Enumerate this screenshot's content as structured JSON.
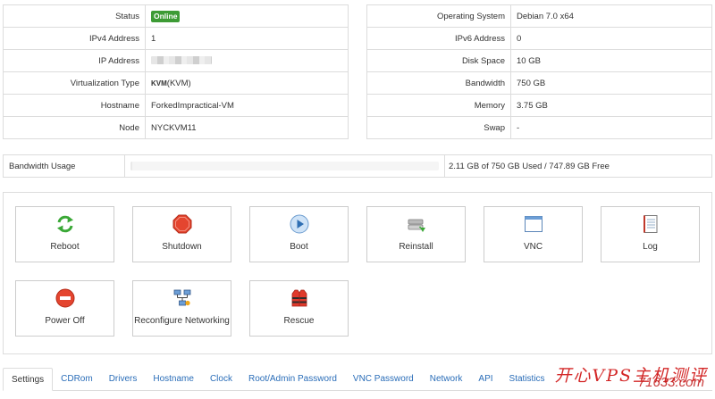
{
  "server_info_left": {
    "status_label": "Status",
    "status_value": "Online",
    "ipv4_label": "IPv4 Address",
    "ipv4_value": "1",
    "ip_label": "IP Address",
    "virt_label": "Virtualization Type",
    "virt_prefix": "KVM",
    "virt_value": "(KVM)",
    "hostname_label": "Hostname",
    "hostname_value": "ForkedImpractical-VM",
    "node_label": "Node",
    "node_value": "NYCKVM11"
  },
  "server_info_right": {
    "os_label": "Operating System",
    "os_value": "Debian 7.0 x64",
    "ipv6_label": "IPv6 Address",
    "ipv6_value": "0",
    "disk_label": "Disk Space",
    "disk_value": "10 GB",
    "bandwidth_label": "Bandwidth",
    "bandwidth_value": "750 GB",
    "memory_label": "Memory",
    "memory_value": "3.75 GB",
    "swap_label": "Swap",
    "swap_value": "-"
  },
  "bandwidth_usage": {
    "label": "Bandwidth Usage",
    "used_fraction": 0.003,
    "summary": "2.11 GB of 750 GB Used / 747.89 GB Free"
  },
  "actions": {
    "reboot": "Reboot",
    "shutdown": "Shutdown",
    "boot": "Boot",
    "reinstall": "Reinstall",
    "vnc": "VNC",
    "log": "Log",
    "power_off": "Power Off",
    "reconfigure_networking": "Reconfigure Networking",
    "rescue": "Rescue"
  },
  "tabs": [
    {
      "label": "Settings",
      "active": true
    },
    {
      "label": "CDRom"
    },
    {
      "label": "Drivers"
    },
    {
      "label": "Hostname"
    },
    {
      "label": "Clock"
    },
    {
      "label": "Root/Admin Password"
    },
    {
      "label": "VNC Password"
    },
    {
      "label": "Network"
    },
    {
      "label": "API"
    },
    {
      "label": "Statistics"
    }
  ],
  "watermark": {
    "text_cn": "开心VPS主机测评",
    "text_url": "71633.com"
  },
  "colors": {
    "online_badge": "#3d9b35",
    "link": "#2a6db8",
    "border": "#dcdcdc",
    "watermark": "#d11b1b"
  }
}
